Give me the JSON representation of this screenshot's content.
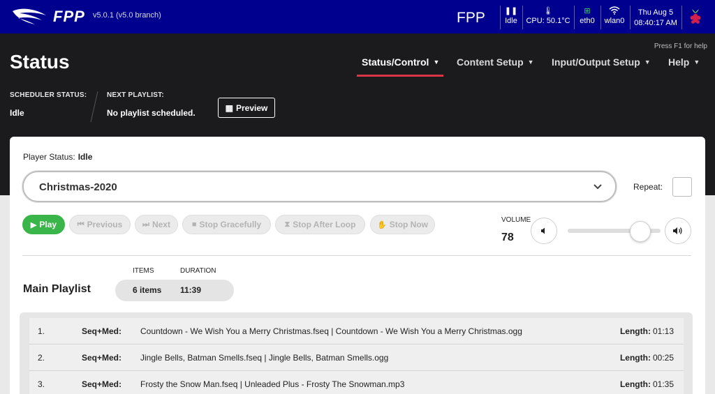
{
  "topbar": {
    "brand": "FPP",
    "version": "v5.0.1 (v5.0 branch)",
    "host": "FPP",
    "status_idle": "Idle",
    "cpu": "CPU: 50.1°C",
    "eth": "eth0",
    "wlan": "wlan0",
    "date": "Thu Aug 5",
    "time": "08:40:17 AM"
  },
  "header": {
    "title": "Status",
    "help_note": "Press F1 for help",
    "nav": [
      {
        "label": "Status/Control"
      },
      {
        "label": "Content Setup"
      },
      {
        "label": "Input/Output Setup"
      },
      {
        "label": "Help"
      }
    ],
    "scheduler_label": "SCHEDULER STATUS:",
    "scheduler_value": "Idle",
    "next_label": "NEXT PLAYLIST:",
    "next_value": "No playlist scheduled.",
    "preview_label": "Preview"
  },
  "player": {
    "status_label": "Player Status:",
    "status_value": "Idle",
    "selected_playlist": "Christmas-2020",
    "repeat_label": "Repeat:",
    "buttons": {
      "play": "Play",
      "previous": "Previous",
      "next": "Next",
      "stop_gracefully": "Stop Gracefully",
      "stop_after_loop": "Stop After Loop",
      "stop_now": "Stop Now"
    },
    "volume_label": "VOLUME",
    "volume": 78
  },
  "playlist": {
    "title": "Main Playlist",
    "items_label": "ITEMS",
    "duration_label": "DURATION",
    "items_value": "6 items",
    "duration_value": "11:39",
    "length_label": "Length:",
    "entries": [
      {
        "num": "1.",
        "type": "Seq+Med:",
        "name": "Countdown - We Wish You a Merry Christmas.fseq | Countdown - We Wish You a Merry Christmas.ogg",
        "length": "01:13"
      },
      {
        "num": "2.",
        "type": "Seq+Med:",
        "name": "Jingle Bells, Batman Smells.fseq | Jingle Bells, Batman Smells.ogg",
        "length": "00:25"
      },
      {
        "num": "3.",
        "type": "Seq+Med:",
        "name": "Frosty the Snow Man.fseq | Unleaded Plus - Frosty The Snowman.mp3",
        "length": "01:35"
      }
    ]
  },
  "colors": {
    "topbar": "#00008f",
    "accent": "#dc3545",
    "play": "#39b54a"
  }
}
